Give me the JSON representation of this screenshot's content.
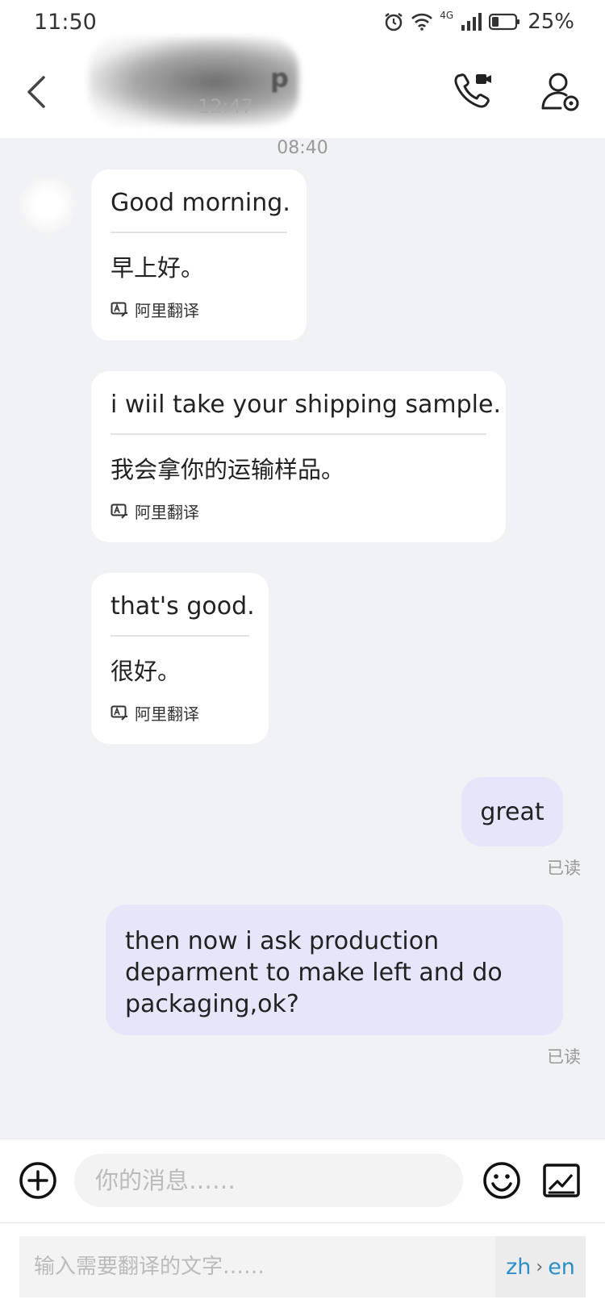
{
  "status_bar": {
    "time": "11:50",
    "network": "4G",
    "battery": "25%"
  },
  "header": {
    "contact_name_fragment": "p",
    "contact_subtitle": "12:47"
  },
  "chat": {
    "timestamp": "08:40",
    "incoming": [
      {
        "original": "Good morning.",
        "translation": "早上好。",
        "translator": "阿里翻译"
      },
      {
        "original": "i wiil take your shipping sample.",
        "translation": "我会拿你的运输样品。",
        "translator": "阿里翻译"
      },
      {
        "original": "that's good.",
        "translation": "很好。",
        "translator": "阿里翻译"
      }
    ],
    "outgoing": [
      {
        "text": "great",
        "status": "已读"
      },
      {
        "lines": [
          "then now i ask production",
          "deparment to make left and do",
          "packaging,ok?"
        ],
        "status": "已读"
      }
    ]
  },
  "input_bar": {
    "placeholder": "你的消息……"
  },
  "translate_bar": {
    "placeholder": "输入需要翻译的文字……",
    "source_lang": "zh",
    "target_lang": "en"
  },
  "colors": {
    "accent_blue": "#2a8fc9",
    "outgoing_bubble": "#e6e6fb",
    "chat_background": "#f1f2f6"
  },
  "icons": [
    "back-chevron-icon",
    "video-call-icon",
    "contact-settings-icon",
    "translate-icon",
    "plus-circle-icon",
    "emoji-icon",
    "image-icon",
    "alarm-icon",
    "wifi-icon",
    "signal-icon",
    "battery-icon"
  ]
}
